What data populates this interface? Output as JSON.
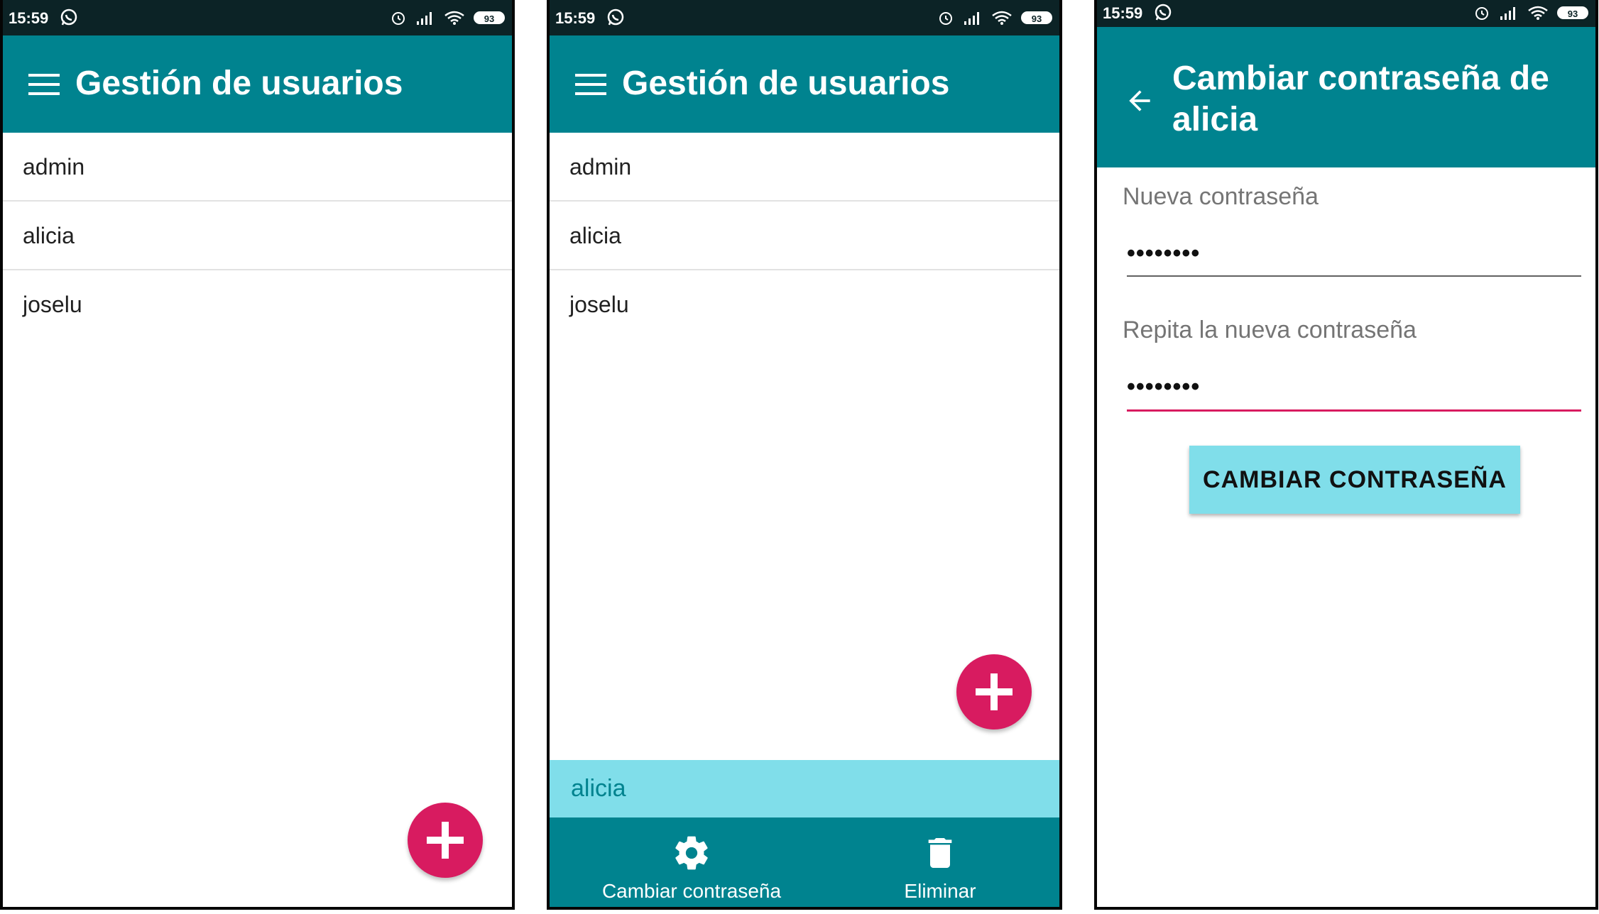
{
  "status_bar": {
    "time": "15:59",
    "battery": "93"
  },
  "screen1": {
    "title": "Gestión de usuarios",
    "users": [
      "admin",
      "alicia",
      "joselu"
    ]
  },
  "screen2": {
    "title": "Gestión de usuarios",
    "users": [
      "admin",
      "alicia",
      "joselu"
    ],
    "selected_user": "alicia",
    "actions": {
      "change_password": "Cambiar contraseña",
      "delete": "Eliminar"
    }
  },
  "screen3": {
    "title": "Cambiar contraseña de alicia",
    "new_password_label": "Nueva contraseña",
    "new_password_value": "••••••••",
    "repeat_password_label": "Repita la nueva contraseña",
    "repeat_password_value": "••••••••",
    "submit_button": "CAMBIAR CONTRASEÑA"
  },
  "colors": {
    "status_bar": "#0c2326",
    "primary": "#00838f",
    "accent": "#d81b60",
    "highlight": "#80deea"
  },
  "icons": [
    "menu-icon",
    "back-arrow-icon",
    "add-icon",
    "settings-gear-icon",
    "trash-icon",
    "whatsapp-icon",
    "alarm-icon",
    "signal-icon",
    "wifi-icon",
    "battery-icon"
  ]
}
